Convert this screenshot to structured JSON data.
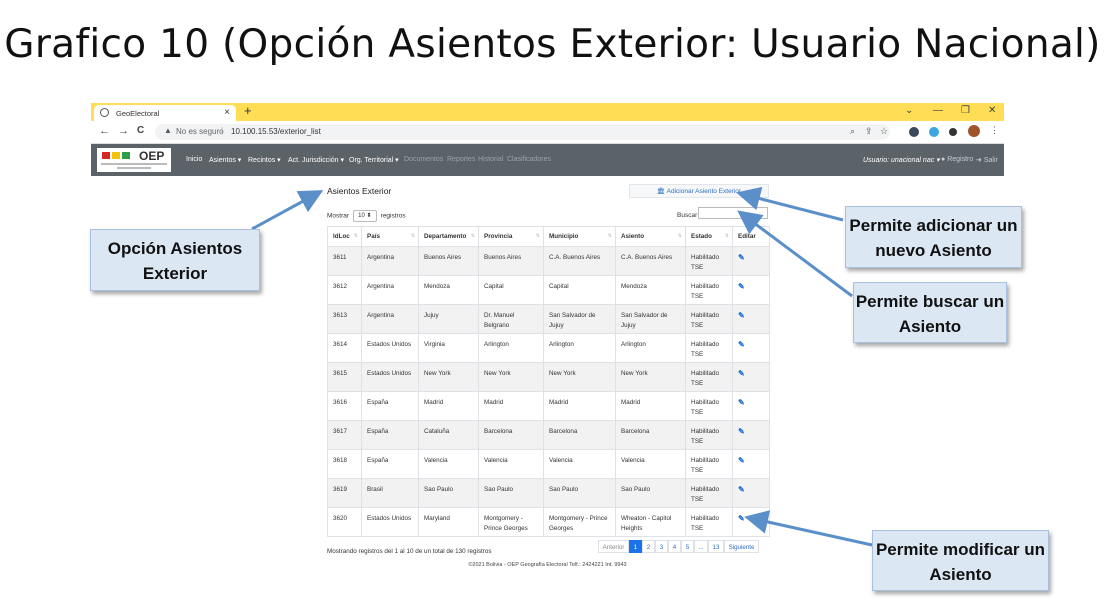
{
  "slide": {
    "title": "Grafico 10 (Opción Asientos Exterior: Usuario Nacional)"
  },
  "browser": {
    "tab_title": "GeoElectoral",
    "tab_close": "×",
    "new_tab": "+",
    "security_label": "No es seguro",
    "url": "10.100.15.53/exterior_list",
    "win_min": "—",
    "win_restore": "❐",
    "win_close": "✕",
    "win_chevron": "⌄",
    "back": "←",
    "forward": "→",
    "reload": "C"
  },
  "navbar": {
    "logo_text": "OEP",
    "items": [
      {
        "label": "Inicio",
        "icon": ""
      },
      {
        "label": "Asientos ▾"
      },
      {
        "label": "Recintos ▾"
      },
      {
        "label": "Act. Jurisdicción ▾"
      },
      {
        "label": "Org. Territorial ▾"
      },
      {
        "label": "Documentos"
      },
      {
        "label": "Reportes"
      },
      {
        "label": "Historial"
      },
      {
        "label": "Clasificadores"
      }
    ],
    "user": "Usuario: unacional nac ▾",
    "registro": "Registro",
    "salir": "Salir",
    "colors": {
      "navbar_bg": "#5b6268",
      "tab_strip": "#ffde55",
      "accent": "#1a73e8"
    }
  },
  "page": {
    "title": "Asientos Exterior",
    "add_button": "Adicionar Asiento Exterior",
    "add_icon": "bank-icon",
    "show_label": "Mostrar",
    "show_value": "10",
    "records_label": "registros",
    "search_label": "Buscar",
    "search_value": "",
    "columns": [
      "IdLoc",
      "País",
      "Departamento",
      "Provincia",
      "Municipio",
      "Asiento",
      "Estado",
      "Editar"
    ],
    "rows": [
      [
        "3611",
        "Argentina",
        "Buenos Aires",
        "Buenos Aires",
        "C.A. Buenos Aires",
        "C.A. Buenos Aires",
        "Habilitado TSE"
      ],
      [
        "3612",
        "Argentina",
        "Mendoza",
        "Capital",
        "Capital",
        "Mendoza",
        "Habilitado TSE"
      ],
      [
        "3613",
        "Argentina",
        "Jujuy",
        "Dr. Manuel Belgrano",
        "San Salvador de Jujuy",
        "San Salvador de Jujuy",
        "Habilitado TSE"
      ],
      [
        "3614",
        "Estados Unidos",
        "Virginia",
        "Arlington",
        "Arlington",
        "Arlington",
        "Habilitado TSE"
      ],
      [
        "3615",
        "Estados Unidos",
        "New York",
        "New York",
        "New York",
        "New York",
        "Habilitado TSE"
      ],
      [
        "3616",
        "España",
        "Madrid",
        "Madrid",
        "Madrid",
        "Madrid",
        "Habilitado TSE"
      ],
      [
        "3617",
        "España",
        "Cataluña",
        "Barcelona",
        "Barcelona",
        "Barcelona",
        "Habilitado TSE"
      ],
      [
        "3618",
        "España",
        "Valencia",
        "Valencia",
        "Valencia",
        "Valencia",
        "Habilitado TSE"
      ],
      [
        "3619",
        "Brasil",
        "Sao Paulo",
        "Sao Paulo",
        "Sao Paulo",
        "Sao Paulo",
        "Habilitado TSE"
      ],
      [
        "3620",
        "Estados Unidos",
        "Maryland",
        "Montgomery - Prince Georges",
        "Montgomery - Prince Georges",
        "Wheaton - Capitol Heights",
        "Habilitado TSE"
      ]
    ],
    "edit_icon": "edit-icon",
    "info": "Mostrando registros del 1 al 10 de un total de 130 registros",
    "pagination": [
      "Anterior",
      "1",
      "2",
      "3",
      "4",
      "5",
      "...",
      "13",
      "Siguiente"
    ],
    "active_page": "1",
    "footer": "©2021 Bolivia - OEP Geografía Electoral Telf.: 2424221 Int. 9943"
  },
  "callouts": {
    "opcion": "Opción Asientos Exterior",
    "adicionar": "Permite adicionar un nuevo Asiento",
    "buscar": "Permite buscar un Asiento",
    "modificar": "Permite modificar un Asiento"
  }
}
